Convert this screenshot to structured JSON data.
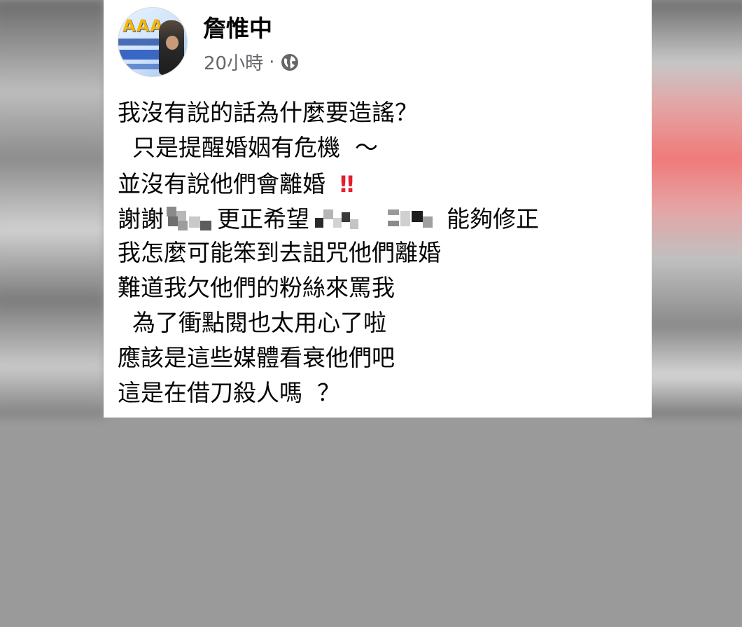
{
  "post": {
    "author": "詹惟中",
    "time": "20小時",
    "separator": "·",
    "privacy_icon": "globe-icon",
    "lines": [
      "我沒有說的話為什麼要造謠？",
      "  只是提醒婚姻有危機  ～",
      "並沒有說他們會離婚 ",
      "謝謝",
      "更正希望",
      "能夠修正",
      "我怎麼可能笨到去詛咒他們離婚",
      "難道我欠他們的粉絲來罵我",
      "  為了衝點閱也太用心了啦",
      "應該是這些媒體看衰他們吧",
      "這是在借刀殺人嗎  ？"
    ],
    "emphasis_mark": "‼",
    "avatar_text": "AAA"
  },
  "colors": {
    "text": "#050505",
    "meta": "#65676b",
    "emphasis": "#e41e2f"
  }
}
